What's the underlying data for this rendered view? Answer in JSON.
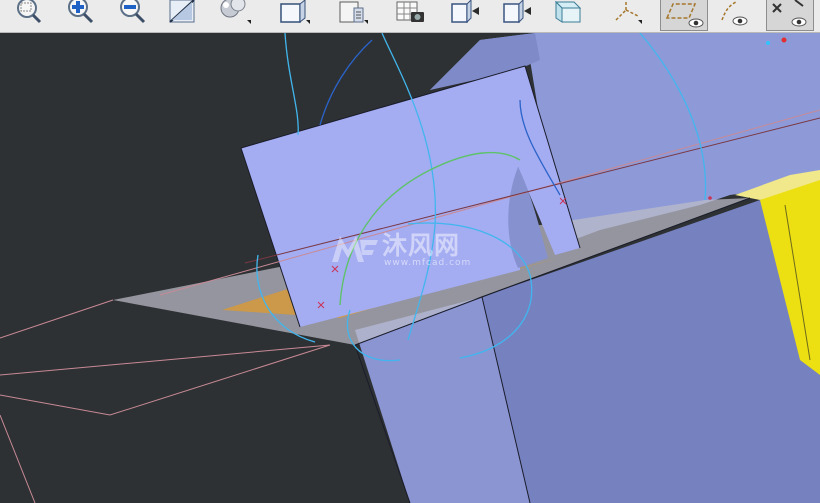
{
  "toolbar": {
    "tools": [
      {
        "name": "zoom-area-icon"
      },
      {
        "name": "zoom-in-icon"
      },
      {
        "name": "zoom-out-icon"
      },
      {
        "name": "normal-view-icon"
      },
      {
        "name": "render-style-icon"
      },
      {
        "name": "iso-view-icon"
      },
      {
        "name": "view-mode-icon"
      },
      {
        "name": "capture-icon"
      },
      {
        "name": "front-view-icon"
      },
      {
        "name": "back-view-icon"
      },
      {
        "name": "hide-show-icon"
      },
      {
        "name": "axis-system-icon"
      },
      {
        "name": "sketch-plane-icon"
      },
      {
        "name": "show-curve-icon"
      },
      {
        "name": "swap-visible-icon"
      }
    ]
  },
  "watermark": {
    "brand": "沐风网",
    "url": "www.mfcad.com"
  },
  "colors": {
    "background": "#2e3133",
    "part_face": "#8c98d6",
    "selected_face": "#a4acf2",
    "plane": "#bcbcc8",
    "yellow_part": "#ecdf12",
    "curve_cyan": "#41b6ee",
    "curve_green": "#5ec26a"
  }
}
